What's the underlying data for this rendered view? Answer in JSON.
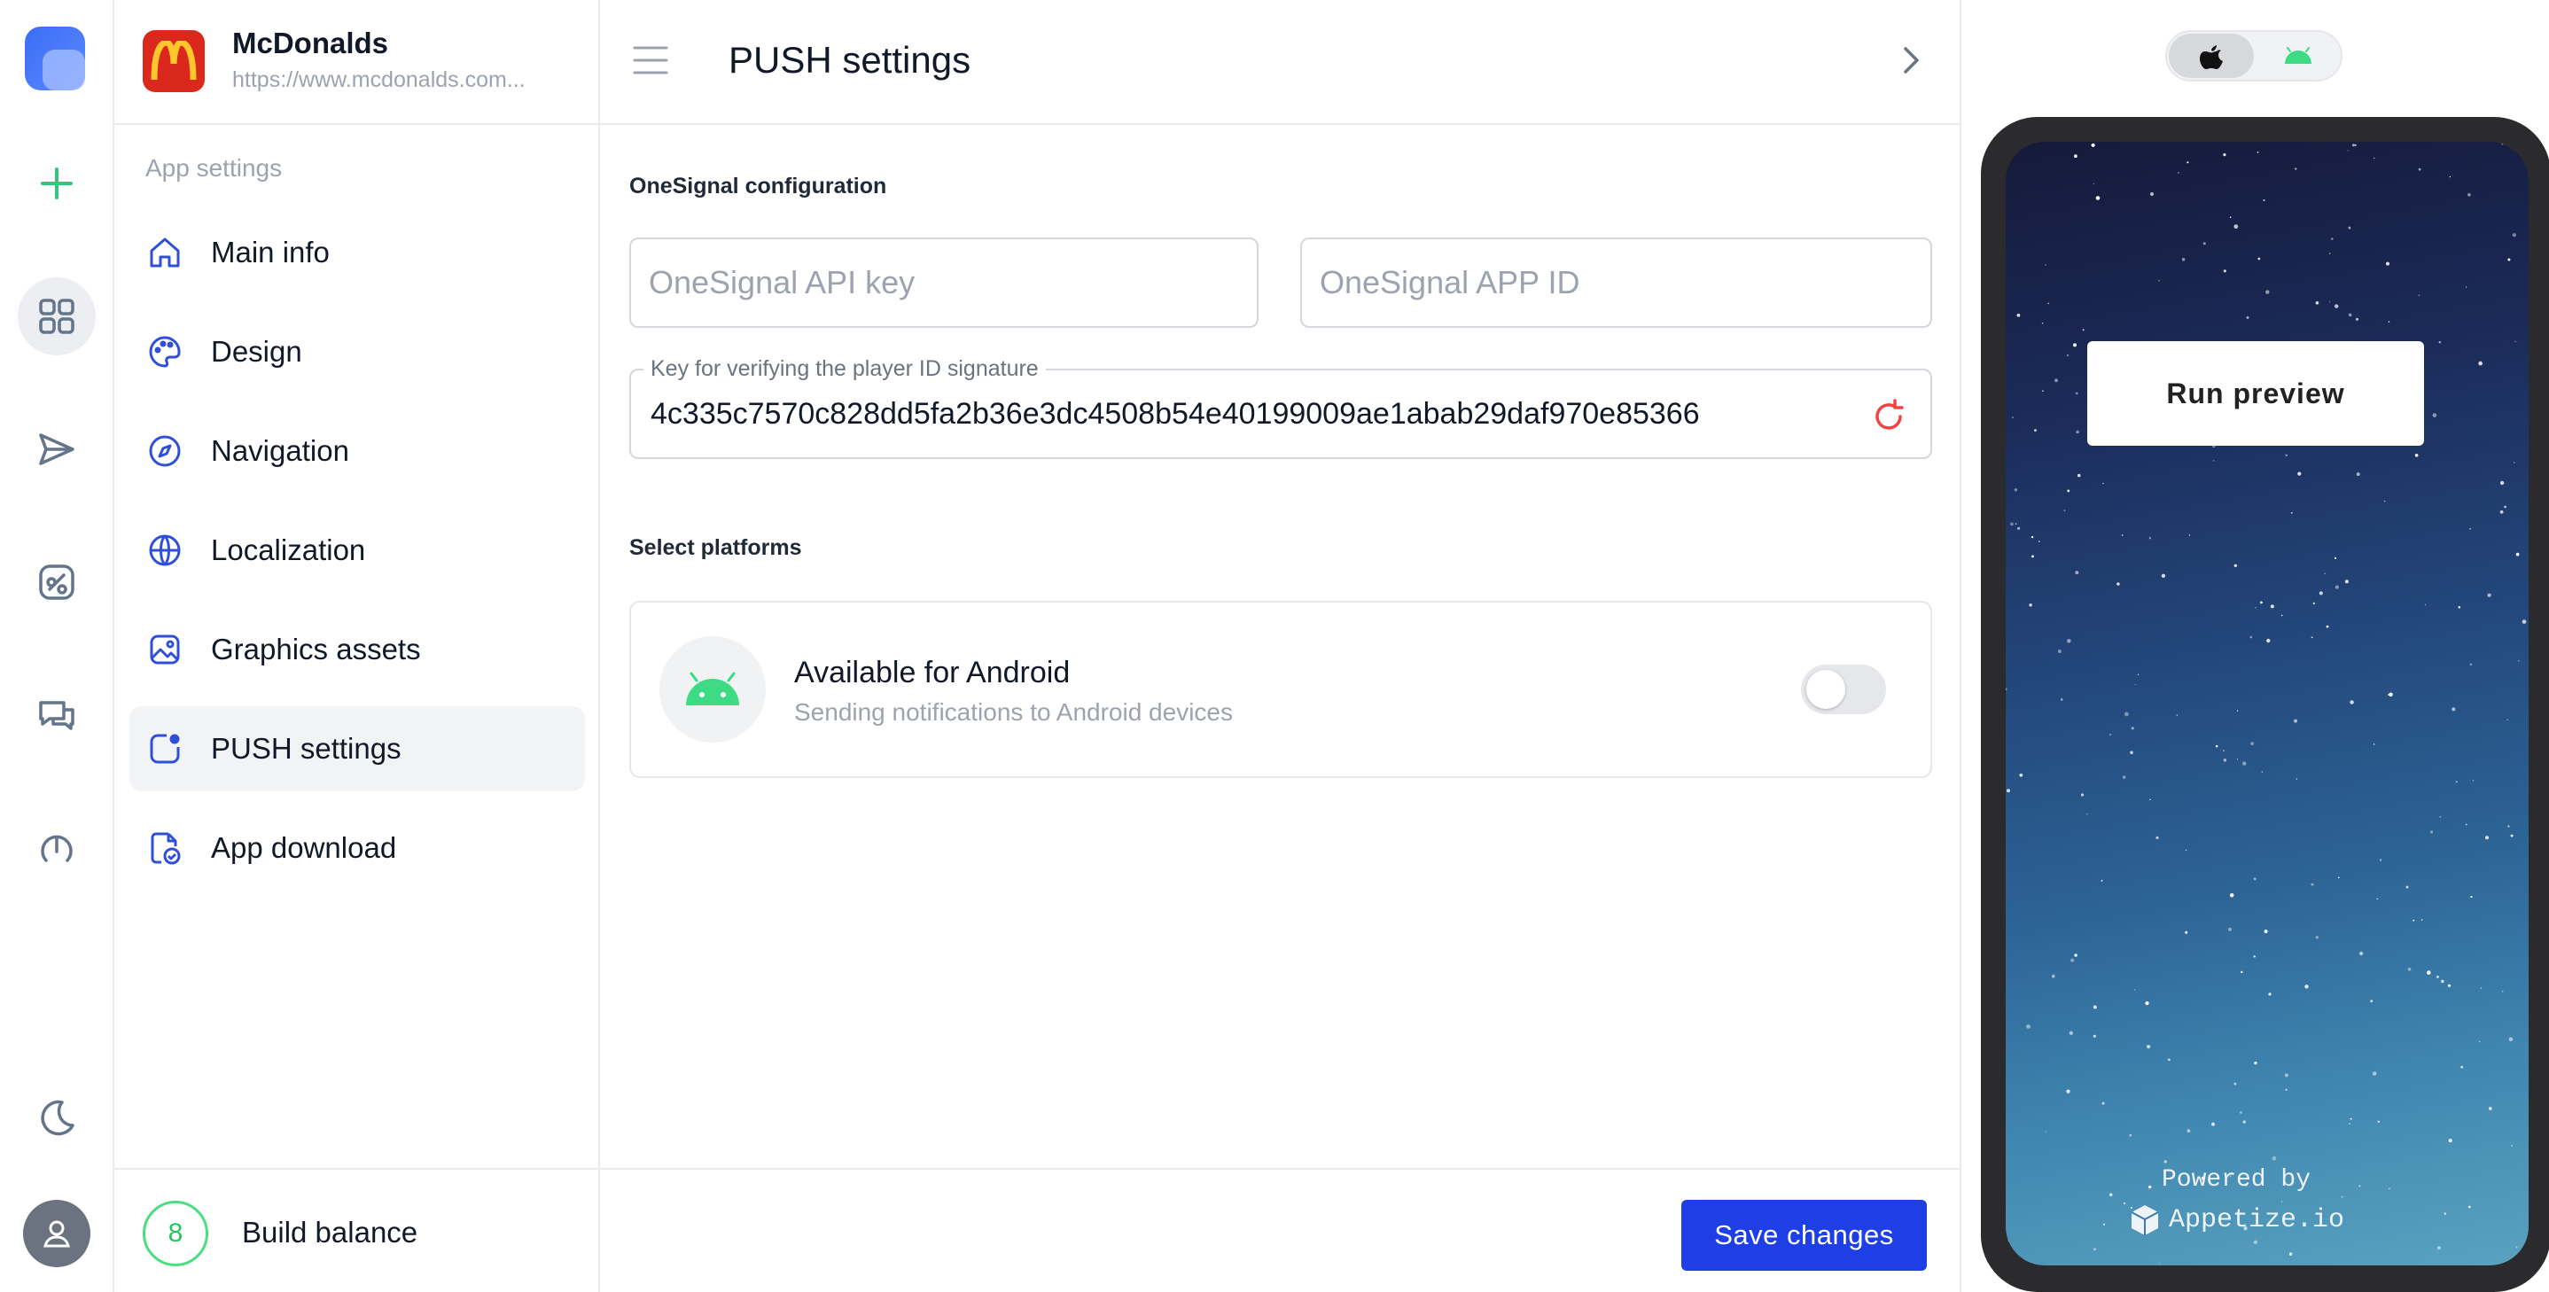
{
  "rail": {
    "items": [
      {
        "icon": "plus-icon"
      },
      {
        "icon": "grid-icon",
        "active": true
      },
      {
        "icon": "send-icon"
      },
      {
        "icon": "integrations-icon"
      },
      {
        "icon": "chat-icon"
      },
      {
        "icon": "speed-icon"
      }
    ],
    "theme_icon": "moon-icon",
    "avatar_icon": "user-icon"
  },
  "app": {
    "name": "McDonalds",
    "url": "https://www.mcdonalds.com...",
    "brand_color": "#da291c"
  },
  "sidebar": {
    "section_label": "App settings",
    "items": [
      {
        "label": "Main info",
        "icon": "home-icon"
      },
      {
        "label": "Design",
        "icon": "palette-icon"
      },
      {
        "label": "Navigation",
        "icon": "compass-icon"
      },
      {
        "label": "Localization",
        "icon": "globe-icon"
      },
      {
        "label": "Graphics assets",
        "icon": "image-icon"
      },
      {
        "label": "PUSH settings",
        "icon": "push-icon",
        "active": true
      },
      {
        "label": "App download",
        "icon": "download-check-icon"
      }
    ],
    "build": {
      "count": "8",
      "label": "Build balance"
    }
  },
  "main": {
    "title": "PUSH settings",
    "onesignal": {
      "title": "OneSignal configuration",
      "api_key_placeholder": "OneSignal API key",
      "app_id_placeholder": "OneSignal APP ID",
      "signature_label": "Key for verifying the player ID signature",
      "signature_value": "4c335c7570c828dd5fa2b36e3dc4508b54e40199009ae1abab29daf970e85366"
    },
    "platforms": {
      "title": "Select platforms",
      "android": {
        "title": "Available for Android",
        "subtitle": "Sending notifications to Android devices",
        "enabled": false
      }
    },
    "save_label": "Save changes"
  },
  "preview": {
    "os_selected": "ios",
    "run_label": "Run preview",
    "powered_by": "Powered by",
    "provider": "Appetize.io"
  },
  "colors": {
    "accent": "#1d3fe5",
    "icon_blue": "#1e40af",
    "green": "#22c55e",
    "refresh_red": "#ef4444"
  }
}
